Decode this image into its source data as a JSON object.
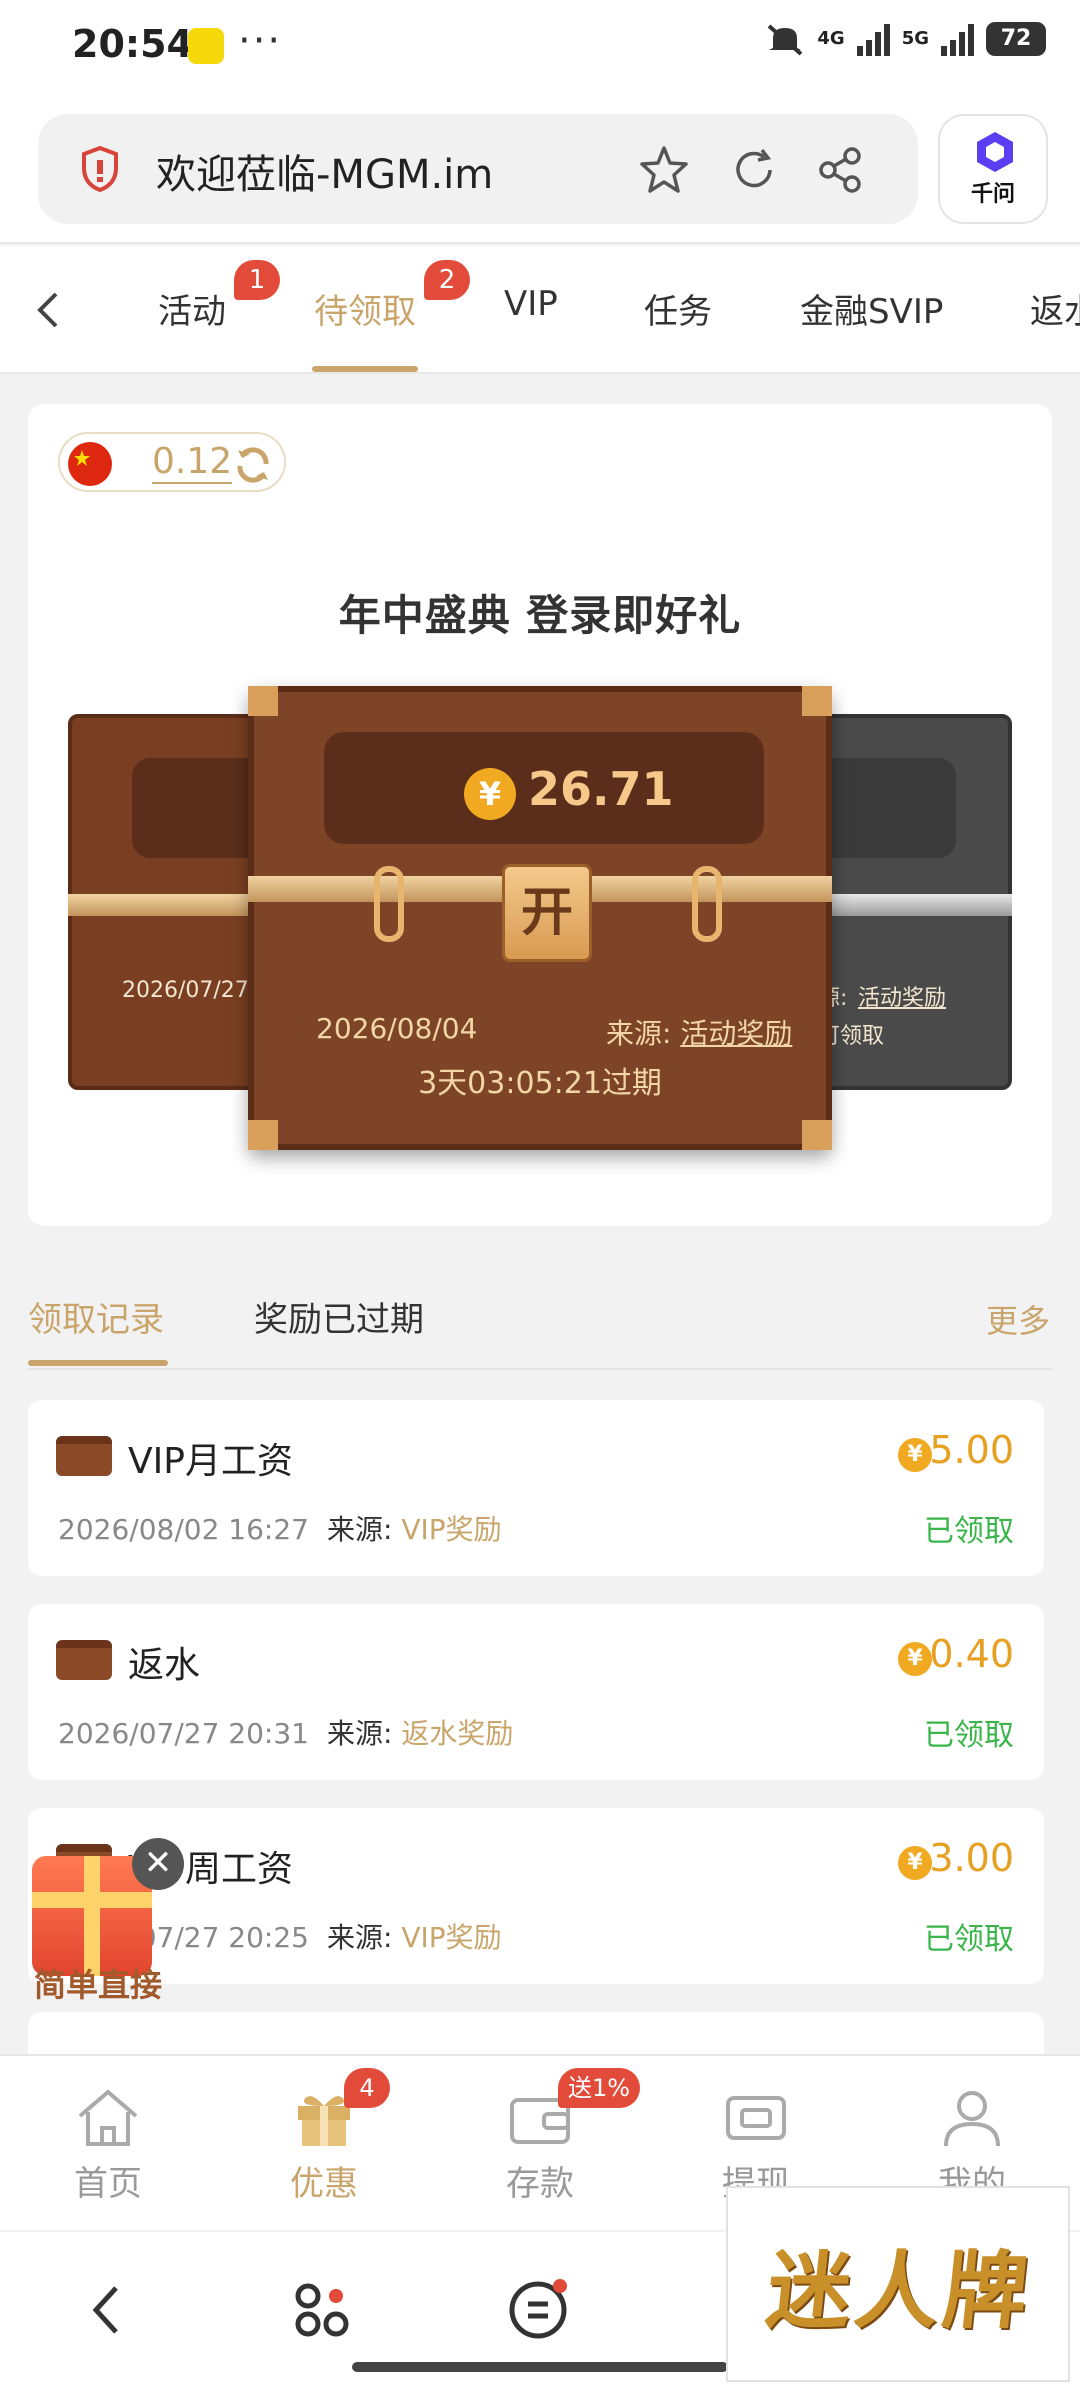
{
  "status_bar": {
    "time": "20:54",
    "dots": "···",
    "net_1": "4G",
    "net_2": "5G",
    "battery": "72"
  },
  "browser": {
    "url": "欢迎莅临-MGM.im",
    "assistant_label": "千问"
  },
  "tabs": [
    {
      "label": "活动",
      "badge": "1"
    },
    {
      "label": "待领取",
      "badge": "2"
    },
    {
      "label": "VIP"
    },
    {
      "label": "任务"
    },
    {
      "label": "金融SVIP"
    },
    {
      "label": "返水"
    }
  ],
  "balance": {
    "value": "0.12"
  },
  "card": {
    "title": "年中盛典 登录即好礼",
    "open_label": "开",
    "coin_symbol": "¥",
    "amount": "26.71",
    "date": "2026/08/04",
    "source_label": "来源:",
    "source_value": "活动奖励",
    "expire": "3天03:05:21过期",
    "left_date": "2026/07/27",
    "right_source_label": "源:",
    "right_source_value": "活动奖励",
    "right_action": "可领取"
  },
  "record_tabs": {
    "records": "领取记录",
    "expired": "奖励已过期",
    "more": "更多"
  },
  "records": [
    {
      "title": "VIP月工资",
      "datetime": "2026/08/02 16:27",
      "source_label": "来源:",
      "source": "VIP奖励",
      "amount": "5.00",
      "status": "已领取"
    },
    {
      "title": "返水",
      "datetime": "2026/07/27 20:31",
      "source_label": "来源:",
      "source": "返水奖励",
      "amount": "0.40",
      "status": "已领取"
    },
    {
      "title": "VIP周工资",
      "datetime": "2026/07/27 20:25",
      "source_label": "来源:",
      "source": "VIP奖励",
      "amount": "3.00",
      "status": "已领取"
    }
  ],
  "record_coin": "¥",
  "floating_gift": {
    "label": "简单直接",
    "close": "✕"
  },
  "bottom_nav": [
    {
      "label": "首页",
      "icon": "home-icon"
    },
    {
      "label": "优惠",
      "icon": "gift-icon",
      "badge": "4"
    },
    {
      "label": "存款",
      "icon": "wallet-icon",
      "badge": "送1%"
    },
    {
      "label": "提现",
      "icon": "withdraw-icon"
    },
    {
      "label": "我的",
      "icon": "profile-icon"
    }
  ],
  "watermark": "迷人牌",
  "colors": {
    "accent": "#c9a56b",
    "badge": "#e24b3a",
    "success": "#39b54a",
    "coin": "#f2a922"
  }
}
